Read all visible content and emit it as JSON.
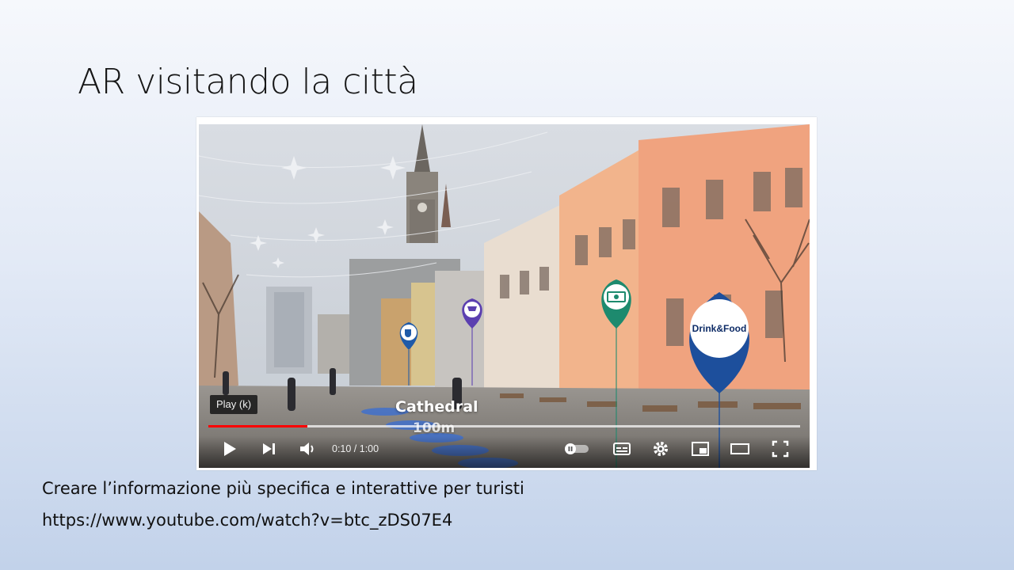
{
  "slide": {
    "title": "AR visitando la città",
    "caption_line1": "Creare l’informazione più specifica e interattive per turisti",
    "caption_line2": "https://www.youtube.com/watch?v=btc_zDS07E4"
  },
  "video": {
    "tooltip": "Play (k)",
    "ar_labels": {
      "poi_name": "Cathedral",
      "distance": "100m",
      "pin_label": "Drink&Food"
    },
    "pins": [
      {
        "icon": "coffee-icon",
        "color": "#1e5aa8"
      },
      {
        "icon": "shopping-cart-icon",
        "color": "#5b3fb0"
      },
      {
        "icon": "money-icon",
        "color": "#1d8a6e"
      },
      {
        "icon": "drink-food-icon",
        "color": "#1d4f9c"
      }
    ],
    "player": {
      "current_time": "0:10",
      "duration": "1:00",
      "time_text": "0:10 / 1:00",
      "progress_fraction": 0.167,
      "buffered_fraction": 1.0,
      "progress_color": "#ff0000",
      "buttons": [
        "play-icon",
        "next-icon",
        "volume-icon",
        "autoplay-toggle-icon",
        "subtitles-icon",
        "settings-icon",
        "miniplayer-icon",
        "theater-mode-icon",
        "fullscreen-icon"
      ]
    }
  }
}
